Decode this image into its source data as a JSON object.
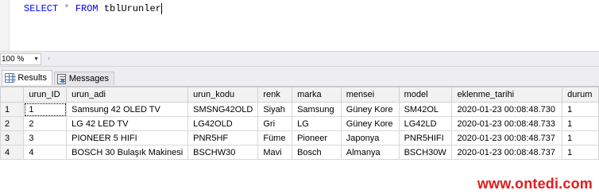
{
  "editor": {
    "query_keyword_select": "SELECT",
    "query_star": "*",
    "query_keyword_from": "FROM",
    "query_table": "tblUrunler"
  },
  "zoom": {
    "value": "100 %"
  },
  "tabs": {
    "results_label": "Results",
    "messages_label": "Messages"
  },
  "grid": {
    "columns": [
      "urun_ID",
      "urun_adi",
      "urun_kodu",
      "renk",
      "marka",
      "mensei",
      "model",
      "eklenme_tarihi",
      "durum"
    ],
    "rows": [
      {
        "n": "1",
        "cells": [
          "1",
          "Samsung 42 OLED TV",
          "SMSNG42OLD",
          "Siyah",
          "Samsung",
          "Güney Kore",
          "SM42OL",
          "2020-01-23 00:08:48.730",
          "1"
        ]
      },
      {
        "n": "2",
        "cells": [
          "2",
          "LG 42 LED TV",
          "LG42OLD",
          "Gri",
          "LG",
          "Güney Kore",
          "LG42LD",
          "2020-01-23 00:08:48.733",
          "1"
        ]
      },
      {
        "n": "3",
        "cells": [
          "3",
          "PIONEER 5 HIFI",
          "PNR5HF",
          "Füme",
          "Pioneer",
          "Japonya",
          "PNR5HIFI",
          "2020-01-23 00:08:48.737",
          "1"
        ]
      },
      {
        "n": "4",
        "cells": [
          "4",
          "BOSCH 30 Bulaşık Makinesi",
          "BSCHW30",
          "Mavi",
          "Bosch",
          "Almanya",
          "BSCH30W",
          "2020-01-23 00:08:48.737",
          "1"
        ]
      }
    ]
  },
  "watermark": "www.ontedi.com",
  "colors": {
    "keyword": "#0000ff",
    "operator": "#808080",
    "watermark": "#e31b1b"
  }
}
